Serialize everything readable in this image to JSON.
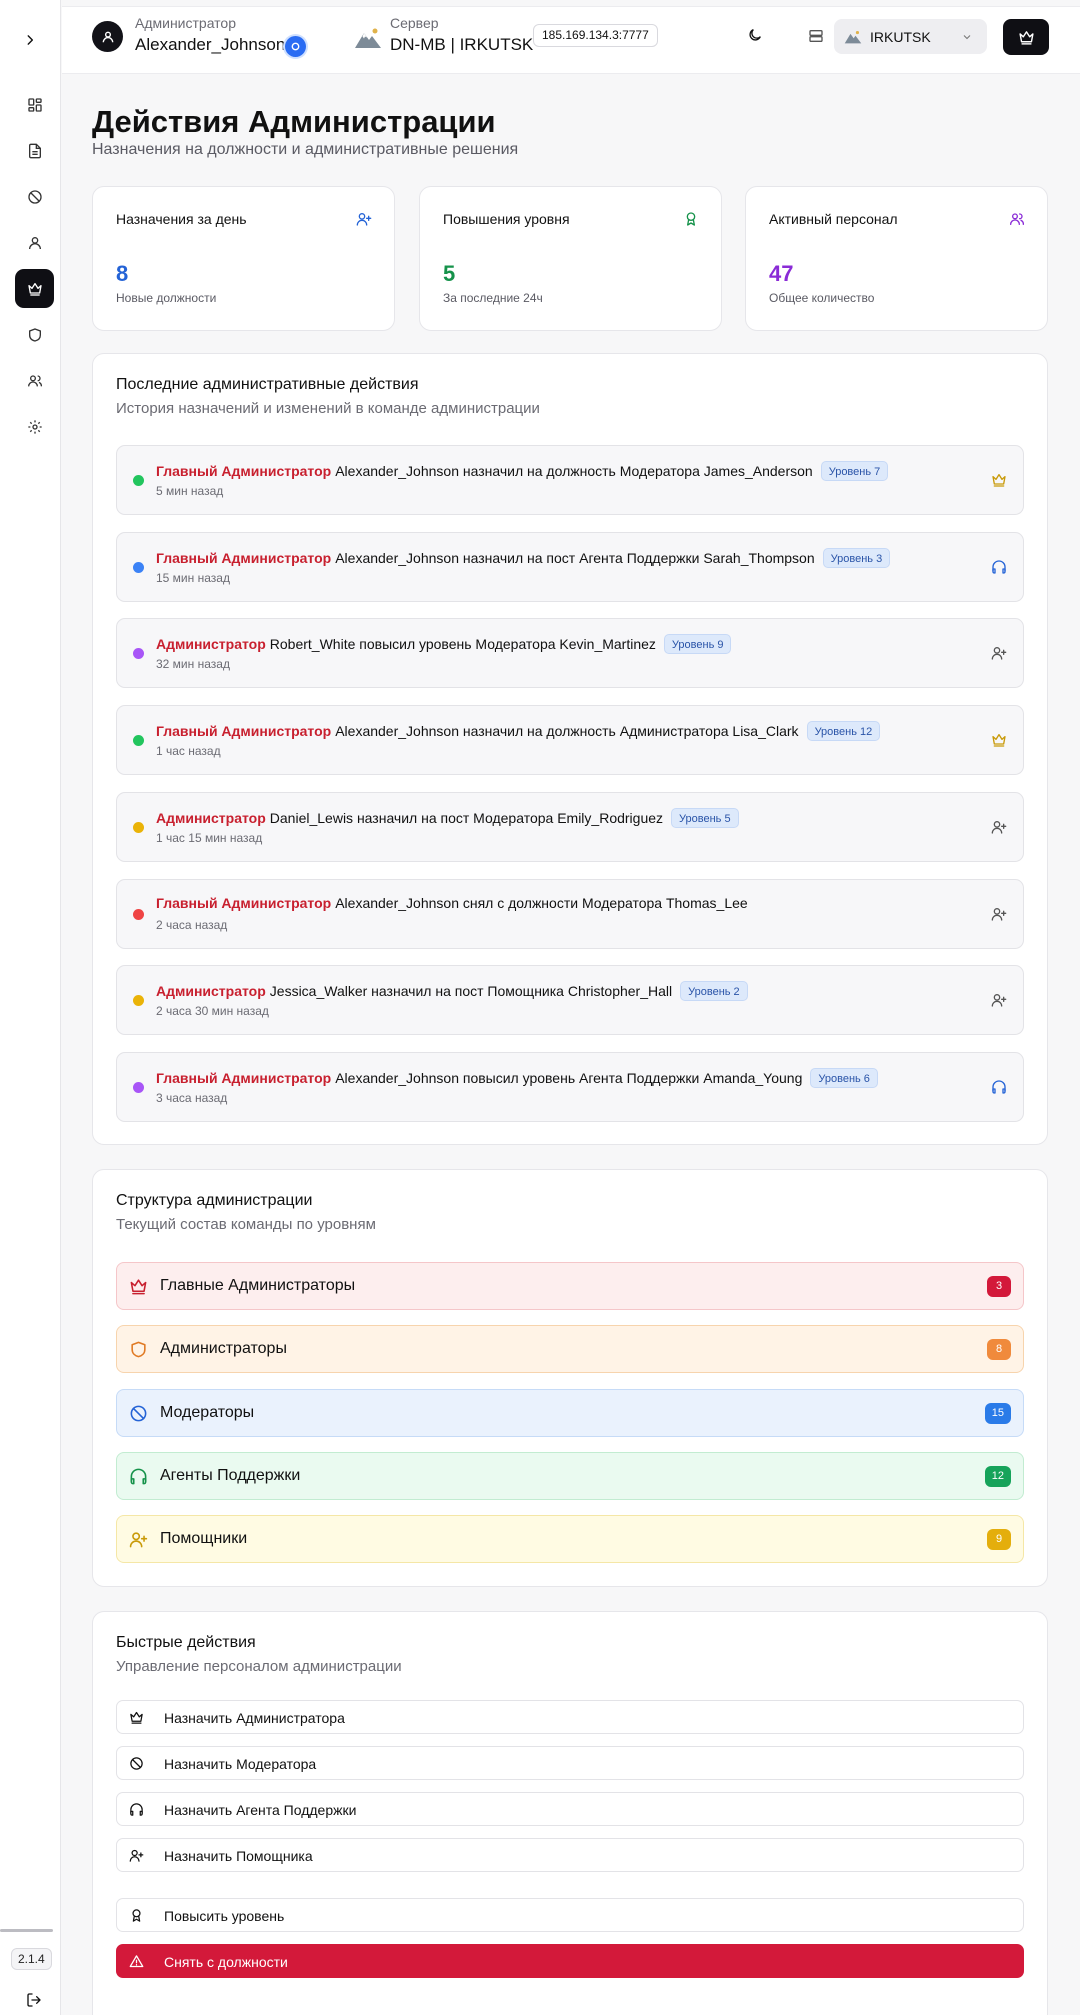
{
  "app": {
    "version": "2.1.4"
  },
  "header": {
    "role_label": "Администратор",
    "username": "Alexander_Johnson",
    "server_label": "Сервер",
    "server_name": "DN-MB | IRKUTSK",
    "ip": "185.169.134.3:7777",
    "server_select_value": "IRKUTSK"
  },
  "page": {
    "title": "Действия Администрации",
    "subtitle": "Назначения на должности и административные решения"
  },
  "stats": [
    {
      "title": "Назначения за день",
      "value": "8",
      "sub": "Новые должности",
      "color": "#2463d6",
      "icon": "user-plus-icon"
    },
    {
      "title": "Повышения уровня",
      "value": "5",
      "sub": "За последние 24ч",
      "color": "#15924a",
      "icon": "award-icon"
    },
    {
      "title": "Активный персонал",
      "value": "47",
      "sub": "Общее количество",
      "color": "#8a2bd6",
      "icon": "users-icon"
    }
  ],
  "recent": {
    "title": "Последние административные действия",
    "subtitle": "История назначений и изменений в команде администрации",
    "items": [
      {
        "role": "Главный Администратор",
        "text": "Alexander_Johnson назначил на должность Модератора James_Anderson",
        "level": "Уровень 7",
        "time": "5 мин назад",
        "dot": "#22c55e",
        "icon": "crown-icon"
      },
      {
        "role": "Главный Администратор",
        "text": "Alexander_Johnson назначил на пост Агента Поддержки Sarah_Thompson",
        "level": "Уровень 3",
        "time": "15 мин назад",
        "dot": "#3b82f6",
        "icon": "headphones-icon"
      },
      {
        "role": "Администратор",
        "text": "Robert_White повысил уровень Модератора Kevin_Martinez",
        "level": "Уровень 9",
        "time": "32 мин назад",
        "dot": "#a855f7",
        "icon": "user-plus-icon"
      },
      {
        "role": "Главный Администратор",
        "text": "Alexander_Johnson назначил на должность Администратора Lisa_Clark",
        "level": "Уровень 12",
        "time": "1 час назад",
        "dot": "#22c55e",
        "icon": "crown-icon"
      },
      {
        "role": "Администратор",
        "text": "Daniel_Lewis назначил на пост Модератора Emily_Rodriguez",
        "level": "Уровень 5",
        "time": "1 час 15 мин назад",
        "dot": "#eab308",
        "icon": "user-plus-icon"
      },
      {
        "role": "Главный Администратор",
        "text": "Alexander_Johnson снял с должности Модератора Thomas_Lee",
        "level": "",
        "time": "2 часа назад",
        "dot": "#ef4444",
        "icon": "user-plus-icon"
      },
      {
        "role": "Администратор",
        "text": "Jessica_Walker назначил на пост Помощника Christopher_Hall",
        "level": "Уровень 2",
        "time": "2 часа 30 мин назад",
        "dot": "#eab308",
        "icon": "user-plus-icon"
      },
      {
        "role": "Главный Администратор",
        "text": "Alexander_Johnson повысил уровень Агента Поддержки Amanda_Young",
        "level": "Уровень 6",
        "time": "3 часа назад",
        "dot": "#a855f7",
        "icon": "headphones-icon"
      }
    ]
  },
  "structure": {
    "title": "Структура администрации",
    "subtitle": "Текущий состав команды по уровням",
    "tiers": [
      {
        "label": "Главные Администраторы",
        "count": "3",
        "bg": "#fdeeee",
        "border": "#f5c6c9",
        "badge": "#d3193a",
        "icon": "crown-icon",
        "iconColor": "#c8202f"
      },
      {
        "label": "Администраторы",
        "count": "8",
        "bg": "#fff3e6",
        "border": "#f7d4ad",
        "badge": "#f08a3c",
        "icon": "shield-icon",
        "iconColor": "#e07a24"
      },
      {
        "label": "Модераторы",
        "count": "15",
        "bg": "#eaf2fd",
        "border": "#c6dbf7",
        "badge": "#2a7be8",
        "icon": "ban-icon",
        "iconColor": "#2463d6"
      },
      {
        "label": "Агенты Поддержки",
        "count": "12",
        "bg": "#eafaf0",
        "border": "#c2ecd1",
        "badge": "#16a35a",
        "icon": "headphones-icon",
        "iconColor": "#15924a"
      },
      {
        "label": "Помощники",
        "count": "9",
        "bg": "#fffbe3",
        "border": "#f5e7a6",
        "badge": "#e4ae0c",
        "icon": "user-plus-icon",
        "iconColor": "#c99a08"
      }
    ]
  },
  "quick": {
    "title": "Быстрые действия",
    "subtitle": "Управление персоналом администрации",
    "actions": [
      {
        "label": "Назначить Администратора",
        "icon": "crown-icon"
      },
      {
        "label": "Назначить Модератора",
        "icon": "ban-icon"
      },
      {
        "label": "Назначить Агента Поддержки",
        "icon": "headphones-icon"
      },
      {
        "label": "Назначить Помощника",
        "icon": "user-plus-icon"
      },
      {
        "label": "Повысить уровень",
        "icon": "award-icon"
      },
      {
        "label": "Снять с должности",
        "icon": "alert-triangle-icon",
        "danger": true
      }
    ]
  }
}
